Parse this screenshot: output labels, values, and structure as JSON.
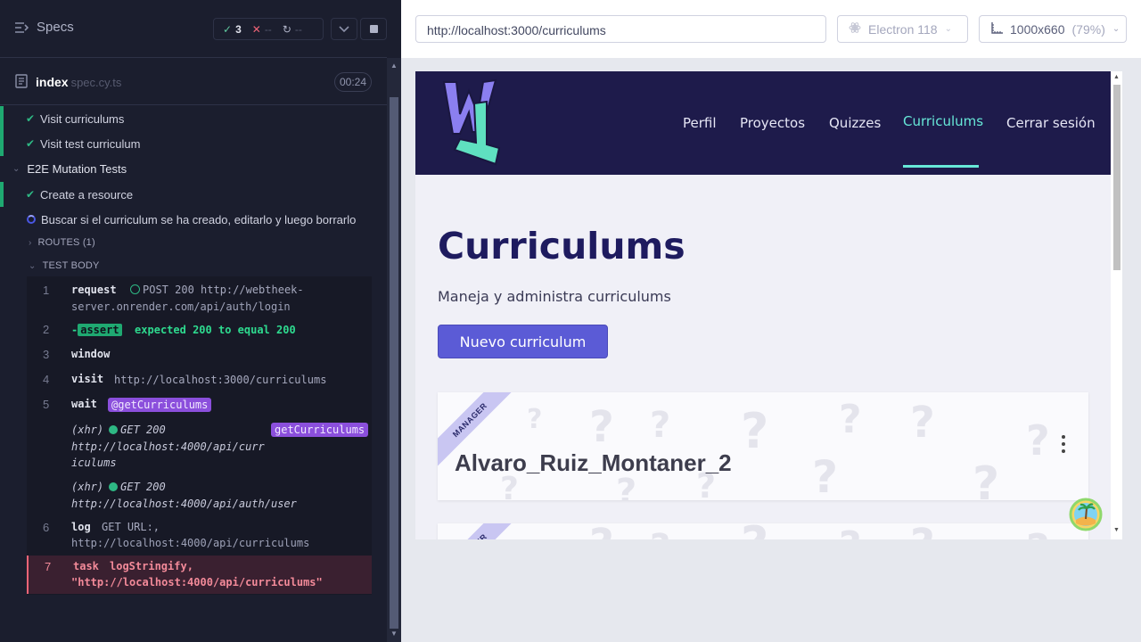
{
  "runner": {
    "header": {
      "title": "Specs",
      "passed": "3",
      "failed": "--",
      "pending": "--"
    },
    "spec": {
      "name": "index",
      "ext": "spec.cy.ts",
      "duration": "00:24"
    },
    "tests": [
      {
        "label": "Visit curriculums",
        "state": "passed"
      },
      {
        "label": "Visit test curriculum",
        "state": "passed"
      },
      {
        "label": "E2E Mutation Tests",
        "state": "suite"
      },
      {
        "label": "Create a resource",
        "state": "passed"
      },
      {
        "label": "Buscar si el curriculum se ha creado, editarlo y luego borrarlo",
        "state": "running"
      }
    ],
    "routes_label": "ROUTES (1)",
    "test_body_label": "TEST BODY",
    "commands": {
      "c1": {
        "num": "1",
        "name": "request",
        "method": "POST 200",
        "url_line1": "http://webtheek-",
        "url_line2": "server.onrender.com/api/auth/login"
      },
      "c2": {
        "num": "2",
        "prefix": "-",
        "badge": "assert",
        "msg": "expected 200 to equal 200"
      },
      "c3": {
        "num": "3",
        "name": "window"
      },
      "c4": {
        "num": "4",
        "name": "visit",
        "msg": "http://localhost:3000/curriculums"
      },
      "c5": {
        "num": "5",
        "name": "wait",
        "alias": "@getCurriculums"
      },
      "xhr1": {
        "tag": "(xhr)",
        "method": "GET 200",
        "line1": "http://localhost:4000/api/curr",
        "line2": "iculums",
        "alias": "getCurriculums"
      },
      "xhr2": {
        "tag": "(xhr)",
        "method": "GET 200",
        "line1": "http://localhost:4000/api/auth/user"
      },
      "c6": {
        "num": "6",
        "name": "log",
        "line1": "GET URL:,",
        "line2": "http://localhost:4000/api/curriculums"
      },
      "c7": {
        "num": "7",
        "name": "task",
        "line1": "logStringify,",
        "line2": "\"http://localhost:4000/api/curriculums\""
      }
    }
  },
  "aut": {
    "url": "http://localhost:3000/curriculums",
    "browser": "Electron 118",
    "viewport": "1000x660",
    "scale": "(79%)",
    "site": {
      "nav": [
        "Perfil",
        "Proyectos",
        "Quizzes",
        "Curriculums",
        "Cerrar sesión"
      ],
      "active_nav": "Curriculums",
      "title": "Curriculums",
      "subtitle": "Maneja y administra curriculums",
      "new_button": "Nuevo curriculum",
      "cards": [
        {
          "role": "MANAGER",
          "name": "Alvaro_Ruiz_Montaner_2"
        },
        {
          "role": "MANAGER",
          "name": ""
        }
      ]
    }
  },
  "colors": {
    "runner_bg": "#1b1e2e",
    "pass": "#1fa971",
    "fail": "#f06477",
    "site_nav": "#1e1b4b",
    "accent": "#5b5bd6",
    "active_link": "#67e8d8"
  }
}
